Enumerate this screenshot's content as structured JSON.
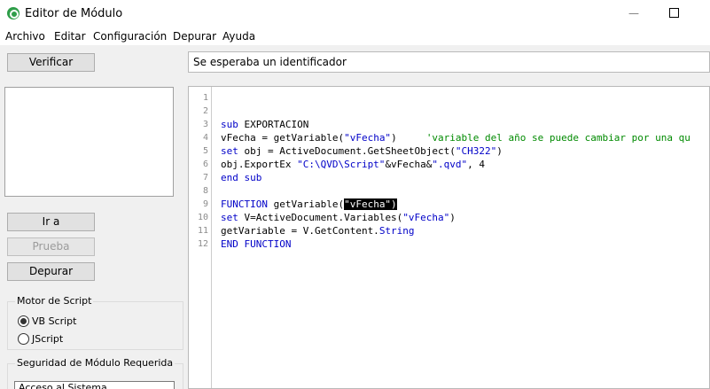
{
  "window": {
    "title": "Editor de Módulo",
    "minimize_glyph": "—"
  },
  "menu": [
    "Archivo",
    "Editar",
    "Configuración",
    "Depurar",
    "Ayuda"
  ],
  "buttons": {
    "verify": "Verificar",
    "goto": "Ir a",
    "test": "Prueba",
    "debug": "Depurar"
  },
  "status": {
    "message": "Se esperaba un identificador"
  },
  "script_engine": {
    "title": "Motor de Script",
    "options": [
      {
        "label": "VB Script",
        "checked": true
      },
      {
        "label": "JScript",
        "checked": false
      }
    ]
  },
  "security": {
    "title": "Seguridad de Módulo Requerida",
    "value": "Acceso al Sistema"
  },
  "editor": {
    "line_numbers": [
      "1",
      "2",
      "3",
      "4",
      "5",
      "6",
      "7",
      "8",
      "9",
      "10",
      "11",
      "12"
    ],
    "lines": [
      [],
      [],
      [
        {
          "t": "sub",
          "c": "kw"
        },
        {
          "t": " EXPORTACION",
          "c": ""
        }
      ],
      [
        {
          "t": "vFecha = getVariable(",
          "c": ""
        },
        {
          "t": "\"vFecha\"",
          "c": "str"
        },
        {
          "t": ")     ",
          "c": ""
        },
        {
          "t": "'variable del año se puede cambiar por una qu",
          "c": "cm"
        }
      ],
      [
        {
          "t": "set",
          "c": "kw"
        },
        {
          "t": " obj = ActiveDocument.GetSheetObject(",
          "c": ""
        },
        {
          "t": "\"CH322\"",
          "c": "str"
        },
        {
          "t": ")",
          "c": ""
        }
      ],
      [
        {
          "t": "obj.ExportEx ",
          "c": ""
        },
        {
          "t": "\"C:\\QVD\\Script\"",
          "c": "str"
        },
        {
          "t": "&vFecha&",
          "c": ""
        },
        {
          "t": "\".qvd\"",
          "c": "str"
        },
        {
          "t": ", 4",
          "c": ""
        }
      ],
      [
        {
          "t": "end sub",
          "c": "kw"
        }
      ],
      [],
      [
        {
          "t": "FUNCTION",
          "c": "kw"
        },
        {
          "t": " getVariable(",
          "c": ""
        },
        {
          "t": "\"vFecha\")",
          "c": "sel"
        }
      ],
      [
        {
          "t": "set",
          "c": "kw"
        },
        {
          "t": " V=ActiveDocument.Variables(",
          "c": ""
        },
        {
          "t": "\"vFecha\"",
          "c": "str"
        },
        {
          "t": ")",
          "c": ""
        }
      ],
      [
        {
          "t": "getVariable = V.GetContent.",
          "c": ""
        },
        {
          "t": "String",
          "c": "kw"
        }
      ],
      [
        {
          "t": "END FUNCTION",
          "c": "kw"
        }
      ]
    ]
  },
  "colors": {
    "keyword": "#0000c8",
    "comment": "#008a00",
    "app_icon": "#2f9e49"
  },
  "icons": {
    "app": "qlikview-icon",
    "minimize": "minimize-icon",
    "maximize": "maximize-icon"
  }
}
